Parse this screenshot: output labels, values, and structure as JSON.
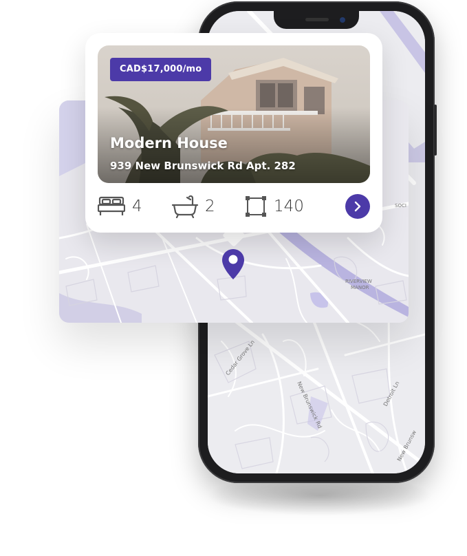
{
  "listing": {
    "price": "CAD$17,000/mo",
    "title": "Modern House",
    "address": "939 New Brunswick Rd Apt. 282",
    "beds": "4",
    "baths": "2",
    "area": "140"
  },
  "map": {
    "labels": {
      "riverview_1": "RIVERVIEW",
      "riverview_2": "MANOR",
      "cedar_grove": "Cedar Grove Ln",
      "new_brunswick": "New Brunswick Rd",
      "detroit": "Detroit Ln",
      "new_brunswick_2": "New Brunsw",
      "soci": "SOCI"
    }
  },
  "icons": {
    "bed": "bed-icon",
    "bath": "bathtub-icon",
    "area": "area-icon",
    "next": "chevron-right-icon",
    "pin": "map-pin-icon"
  },
  "colors": {
    "accent": "#4c3aa8",
    "map_bg": "#e9e8ee",
    "road": "#ffffff",
    "water": "#b9b4e0"
  }
}
